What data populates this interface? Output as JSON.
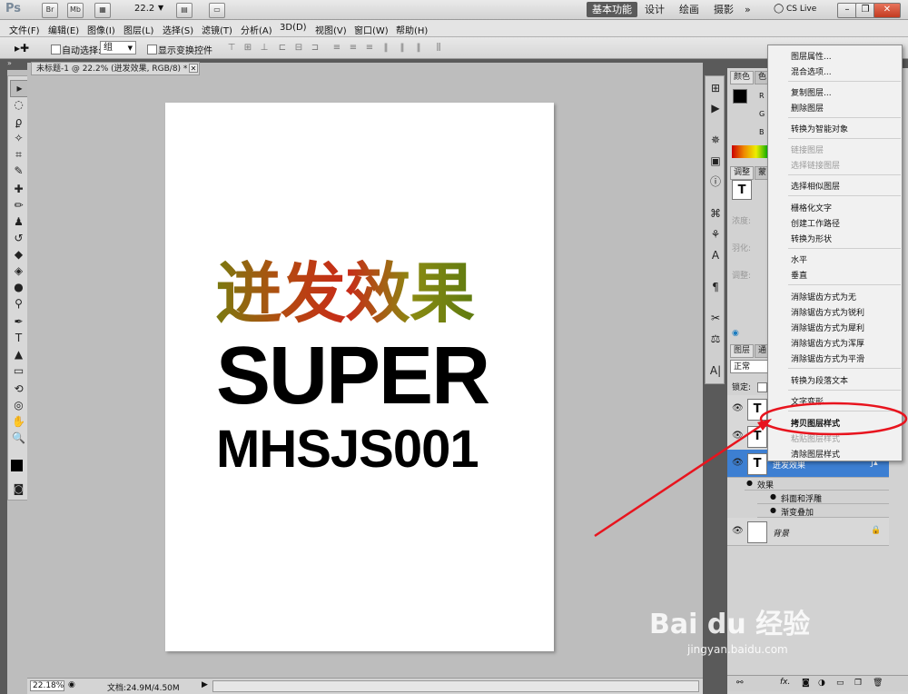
{
  "app": {
    "logo": "Ps",
    "zoom_dropdown": "22.2"
  },
  "workspaces": [
    "基本功能",
    "设计",
    "绘画",
    "摄影",
    "»"
  ],
  "cs_live": "CS Live",
  "menus": [
    "文件(F)",
    "编辑(E)",
    "图像(I)",
    "图层(L)",
    "选择(S)",
    "滤镜(T)",
    "分析(A)",
    "3D(D)",
    "视图(V)",
    "窗口(W)",
    "帮助(H)"
  ],
  "options": {
    "auto_select_label": "自动选择:",
    "auto_select_value": "组",
    "show_transform_label": "显示变换控件"
  },
  "document": {
    "tab_title": "未标题-1 @ 22.2% (迸发效果, RGB/8) *",
    "text_line1": "迸发效果",
    "text_line2": "SUPER",
    "text_line3": "MHSJS001"
  },
  "status": {
    "zoom": "22.18%",
    "doc_info": "文档:24.9M/4.50M"
  },
  "panels": {
    "color_tab": "颜色",
    "swatch_tab": "色",
    "adjust_tab": "调整",
    "style_tab": "蒙",
    "rgb": [
      "R",
      "G",
      "B"
    ],
    "density": "浓度:",
    "feather": "羽化:",
    "refine": "调整:",
    "layers_tab": "图层",
    "channels_tab": "通",
    "blend_mode": "正常",
    "lock_label": "锁定:",
    "layers": [
      {
        "name": "迸发效果",
        "thumb": "T"
      },
      {
        "name": "效果"
      },
      {
        "name": "斜面和浮雕"
      },
      {
        "name": "渐变叠加"
      },
      {
        "name": "背景"
      }
    ]
  },
  "context_menu": {
    "items": [
      {
        "label": "图层属性...",
        "enabled": true
      },
      {
        "label": "混合选项...",
        "enabled": true
      },
      {
        "label": "复制图层...",
        "enabled": true
      },
      {
        "label": "删除图层",
        "enabled": true
      },
      {
        "label": "转换为智能对象",
        "enabled": true
      },
      {
        "label": "链接图层",
        "enabled": false
      },
      {
        "label": "选择链接图层",
        "enabled": false
      },
      {
        "label": "选择相似图层",
        "enabled": true
      },
      {
        "label": "栅格化文字",
        "enabled": true
      },
      {
        "label": "创建工作路径",
        "enabled": true
      },
      {
        "label": "转换为形状",
        "enabled": true
      },
      {
        "label": "水平",
        "enabled": true
      },
      {
        "label": "垂直",
        "enabled": true
      },
      {
        "label": "消除锯齿方式为无",
        "enabled": true
      },
      {
        "label": "消除锯齿方式为锐利",
        "enabled": true
      },
      {
        "label": "消除锯齿方式为犀利",
        "enabled": true
      },
      {
        "label": "消除锯齿方式为浑厚",
        "enabled": true
      },
      {
        "label": "消除锯齿方式为平滑",
        "enabled": true
      },
      {
        "label": "转换为段落文本",
        "enabled": true
      },
      {
        "label": "文字变形...",
        "enabled": true
      },
      {
        "label": "拷贝图层样式",
        "enabled": true
      },
      {
        "label": "粘贴图层样式",
        "enabled": false
      },
      {
        "label": "清除图层样式",
        "enabled": true
      }
    ]
  },
  "watermark": {
    "logo": "Bai du 经验",
    "url": "jingyan.baidu.com"
  },
  "annotation_color": "#e8141e"
}
